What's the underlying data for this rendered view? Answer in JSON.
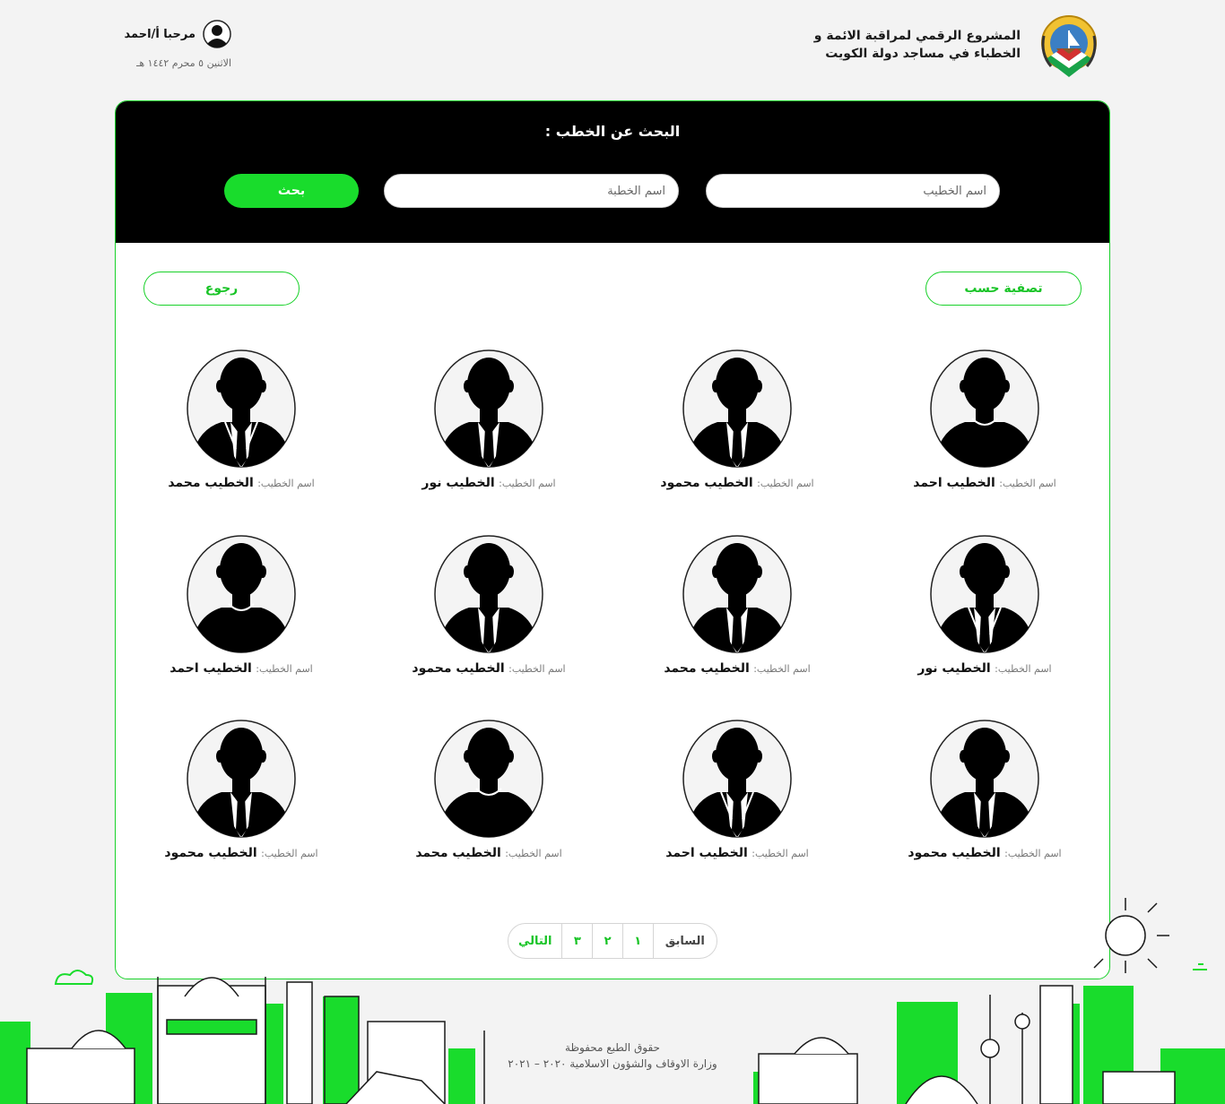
{
  "header": {
    "title_line1": "المشروع الرقمي لمراقبة الائمة و",
    "title_line2": "الخطباء في مساجد دولة الكويت",
    "greeting": "مرحبا أ/احمد",
    "date": "الاثنين ٥ محرم ١٤٤٢ هـ"
  },
  "search": {
    "title": "البحث عن الخطب :",
    "speaker_placeholder": "اسم الخطيب",
    "sermon_placeholder": "اسم الخطبة",
    "button": "بحث"
  },
  "actions": {
    "filter": "تصفية حسب",
    "back": "رجوع"
  },
  "speaker_label": "اسم الخطيب:",
  "speakers": [
    {
      "name": "الخطيب احمد",
      "style": "casual"
    },
    {
      "name": "الخطيب محمود",
      "style": "suit"
    },
    {
      "name": "الخطيب نور",
      "style": "suit"
    },
    {
      "name": "الخطيب محمد",
      "style": "tie"
    },
    {
      "name": "الخطيب نور",
      "style": "tie"
    },
    {
      "name": "الخطيب محمد",
      "style": "suit"
    },
    {
      "name": "الخطيب محمود",
      "style": "suit"
    },
    {
      "name": "الخطيب احمد",
      "style": "casual"
    },
    {
      "name": "الخطيب محمود",
      "style": "suit"
    },
    {
      "name": "الخطيب احمد",
      "style": "tie"
    },
    {
      "name": "الخطيب محمد",
      "style": "casual"
    },
    {
      "name": "الخطيب محمود",
      "style": "suit"
    }
  ],
  "pagination": {
    "prev": "السابق",
    "pages": [
      "١",
      "٢",
      "٣"
    ],
    "next": "التالي"
  },
  "footer": {
    "line1": "حقوق الطبع محفوظة",
    "line2": "وزارة الاوقاف والشؤون الاسلامية ٢٠٢٠ – ٢٠٢١"
  },
  "colors": {
    "accent": "#19dc2c",
    "panel": "#000000",
    "background": "#f3f3f3"
  }
}
